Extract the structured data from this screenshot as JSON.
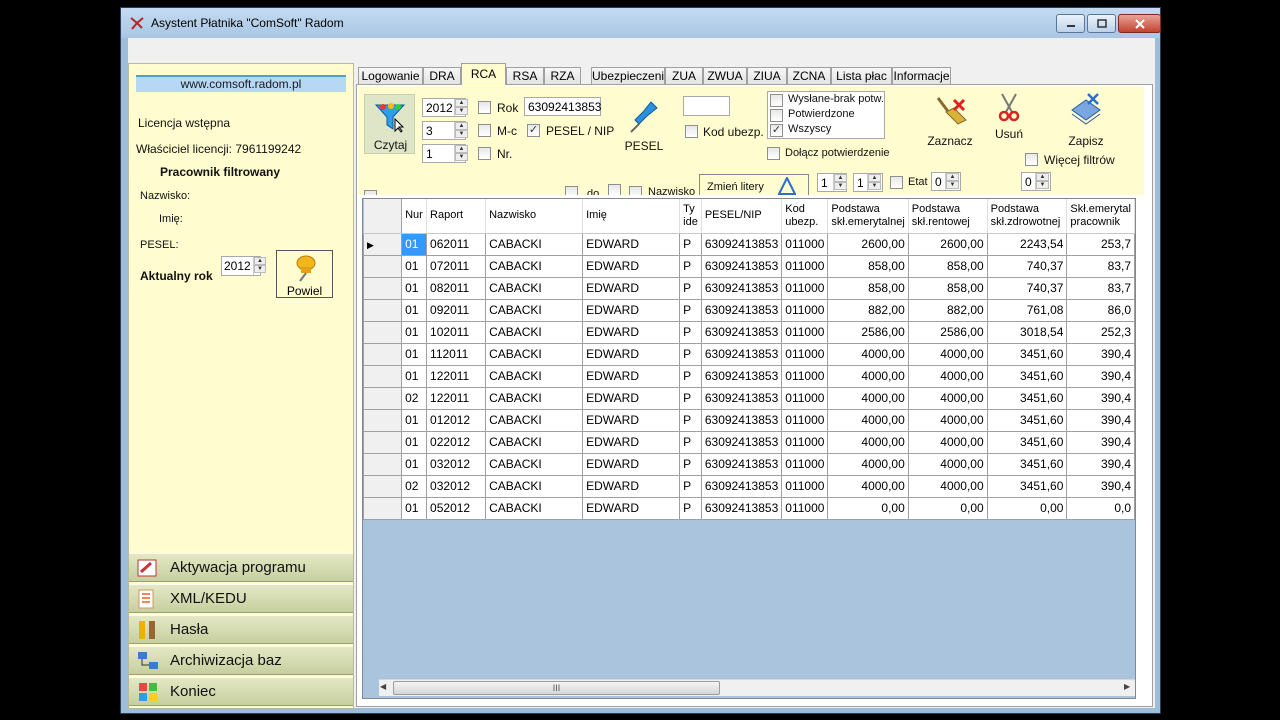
{
  "window": {
    "title": "Asystent Płatnika \"ComSoft\" Radom"
  },
  "left_panel": {
    "site": "www.comsoft.radom.pl",
    "license_label": "Licencja wstępna",
    "owner_label": "Właściciel licencji: 7961199242",
    "filtered_heading": "Pracownik filtrowany",
    "surname_label": "Nazwisko:",
    "name_label": "Imię:",
    "pesel_label": "PESEL:",
    "year_label": "Aktualny rok",
    "year_value": "2012",
    "powiel_label": "Powiel"
  },
  "menu": [
    {
      "label": "Aktywacja programu",
      "icon": "key-icon"
    },
    {
      "label": "XML/KEDU",
      "icon": "document-icon"
    },
    {
      "label": "Hasła",
      "icon": "tools-icon"
    },
    {
      "label": "Archiwizacja baz",
      "icon": "network-icon"
    },
    {
      "label": "Koniec",
      "icon": "windows-logo-icon"
    }
  ],
  "tabs": [
    "Logowanie",
    "DRA",
    "RCA",
    "RSA",
    "RZA",
    "Ubezpieczeni",
    "ZUA",
    "ZWUA",
    "ZIUA",
    "ZCNA",
    "Lista płac",
    "Informacje"
  ],
  "active_tab": "RCA",
  "toolbar": {
    "czytaj_label": "Czytaj",
    "year_value": "2012",
    "month_value": "3",
    "number_value": "1",
    "rok_label": "Rok",
    "mc_label": "M-c",
    "nr_label": "Nr.",
    "pesel_search_value": "63092413853",
    "pesel_nip_label": "PESEL / NIP",
    "pesel_button_label": "PESEL",
    "kod_ubezp_label": "Kod ubezp.",
    "status_options": [
      {
        "label": "Wysłane-brak potw.",
        "checked": false
      },
      {
        "label": "Potwierdzone",
        "checked": false
      },
      {
        "label": "Wszyscy",
        "checked": true
      }
    ],
    "dolacz_label": "Dołącz potwierdzenie",
    "zaznacz_label": "Zaznacz",
    "usun_label": "Usuń",
    "zapisz_label": "Zapisz",
    "wiecej_label": "Więcej filtrów",
    "zmien_label": "Zmień litery",
    "etat_label": "Etat",
    "spin1_value": "1",
    "spin2_value": "1",
    "spin3_value": "0",
    "spin4_value": "0",
    "partial_do_label": "do",
    "partial_nazwisko_label": "Nazwisko"
  },
  "grid": {
    "columns": [
      "Nur",
      "Raport",
      "Nazwisko",
      "Imię",
      "Ty ide",
      "PESEL/NIP",
      "Kod ubezp.",
      "Podstawa skł.emerytalnej",
      "Podstawa skł.rentowej",
      "Podstawa skł.zdrowotnej",
      "Skł.emerytal pracownik"
    ],
    "rows": [
      [
        "01",
        "062011",
        "CABACKI",
        "EDWARD",
        "P",
        "63092413853",
        "011000",
        "2600,00",
        "2600,00",
        "2243,54",
        "253,7"
      ],
      [
        "01",
        "072011",
        "CABACKI",
        "EDWARD",
        "P",
        "63092413853",
        "011000",
        "858,00",
        "858,00",
        "740,37",
        "83,7"
      ],
      [
        "01",
        "082011",
        "CABACKI",
        "EDWARD",
        "P",
        "63092413853",
        "011000",
        "858,00",
        "858,00",
        "740,37",
        "83,7"
      ],
      [
        "01",
        "092011",
        "CABACKI",
        "EDWARD",
        "P",
        "63092413853",
        "011000",
        "882,00",
        "882,00",
        "761,08",
        "86,0"
      ],
      [
        "01",
        "102011",
        "CABACKI",
        "EDWARD",
        "P",
        "63092413853",
        "011000",
        "2586,00",
        "2586,00",
        "3018,54",
        "252,3"
      ],
      [
        "01",
        "112011",
        "CABACKI",
        "EDWARD",
        "P",
        "63092413853",
        "011000",
        "4000,00",
        "4000,00",
        "3451,60",
        "390,4"
      ],
      [
        "01",
        "122011",
        "CABACKI",
        "EDWARD",
        "P",
        "63092413853",
        "011000",
        "4000,00",
        "4000,00",
        "3451,60",
        "390,4"
      ],
      [
        "02",
        "122011",
        "CABACKI",
        "EDWARD",
        "P",
        "63092413853",
        "011000",
        "4000,00",
        "4000,00",
        "3451,60",
        "390,4"
      ],
      [
        "01",
        "012012",
        "CABACKI",
        "EDWARD",
        "P",
        "63092413853",
        "011000",
        "4000,00",
        "4000,00",
        "3451,60",
        "390,4"
      ],
      [
        "01",
        "022012",
        "CABACKI",
        "EDWARD",
        "P",
        "63092413853",
        "011000",
        "4000,00",
        "4000,00",
        "3451,60",
        "390,4"
      ],
      [
        "01",
        "032012",
        "CABACKI",
        "EDWARD",
        "P",
        "63092413853",
        "011000",
        "4000,00",
        "4000,00",
        "3451,60",
        "390,4"
      ],
      [
        "02",
        "032012",
        "CABACKI",
        "EDWARD",
        "P",
        "63092413853",
        "011000",
        "4000,00",
        "4000,00",
        "3451,60",
        "390,4"
      ],
      [
        "01",
        "052012",
        "CABACKI",
        "EDWARD",
        "P",
        "63092413853",
        "011000",
        "0,00",
        "0,00",
        "0,00",
        "0,0"
      ]
    ],
    "current_row": 0,
    "scroll_grip": "III"
  }
}
